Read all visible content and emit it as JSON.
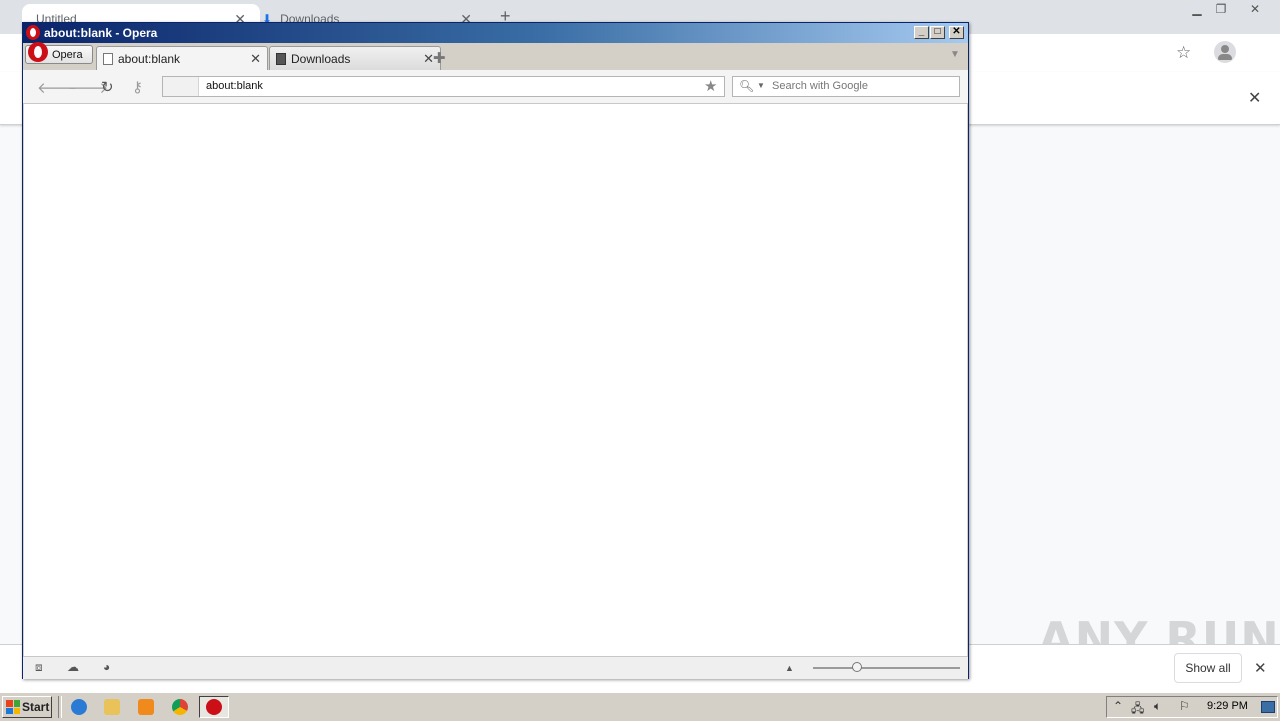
{
  "chrome": {
    "tabs": [
      {
        "label": "Untitled",
        "close": "✕"
      },
      {
        "label": "Downloads",
        "close": "✕"
      }
    ],
    "new_tab": "+",
    "download_bar": {
      "show_all": "Show all",
      "close": "✕"
    },
    "infobar_close": "✕",
    "watermark": "ANY RUN"
  },
  "opera": {
    "window_title": "about:blank - Opera",
    "menu_button": "Opera",
    "tabs": [
      {
        "label": "about:blank",
        "close": "✕",
        "active": true
      },
      {
        "label": "Downloads",
        "close": "✕",
        "active": false
      }
    ],
    "new_tab": "✚",
    "address": {
      "value": "about:blank"
    },
    "search": {
      "placeholder": "Search with Google"
    },
    "zoom": {
      "level": 0.3
    }
  },
  "taskbar": {
    "start_label": "Start",
    "clock": "9:29 PM",
    "colors": {
      "opera_red": "#cc0f16",
      "xp_blue": "#0a246a"
    }
  }
}
